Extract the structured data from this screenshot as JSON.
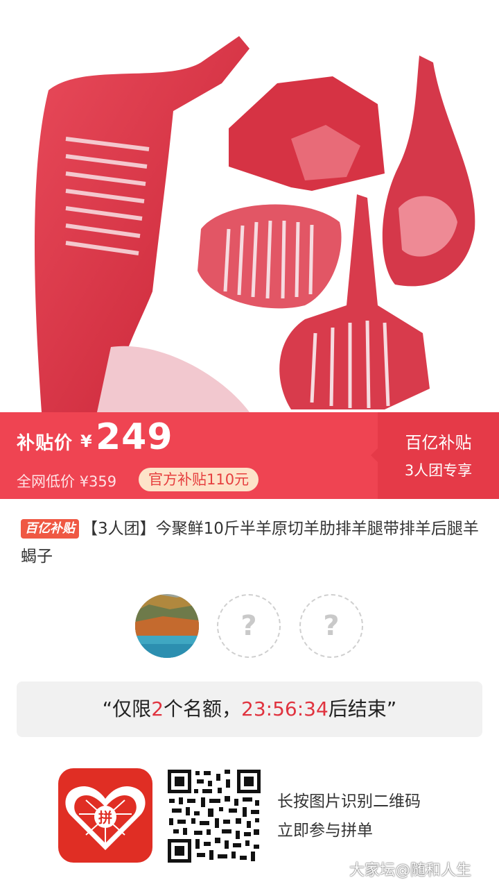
{
  "price_bar": {
    "subsidy_label": "补贴价",
    "currency": "¥",
    "price": "249",
    "original_price": "全网低价 ¥359",
    "subsidy_pill": "官方补贴110元",
    "right_title": "百亿补贴",
    "right_sub": "3人团专享"
  },
  "product": {
    "badge": "百亿补贴",
    "title": "【3人团】今聚鲜10斤半羊原切羊肋排羊腿带排羊后腿羊蝎子"
  },
  "group": {
    "unknown_mark": "?"
  },
  "notice": {
    "open_quote": "“仅限",
    "slots": "2",
    "mid": "个名额，",
    "timer": "23:56:34",
    "end": "后结束”"
  },
  "footer": {
    "line1": "长按图片识别二维码",
    "line2": "立即参与拼单",
    "logo_text": "拼"
  },
  "watermark": "大家坛@随和人生",
  "colors": {
    "accent": "#ef4452",
    "accent_dark": "#e53a48",
    "highlight": "#e0333f"
  }
}
